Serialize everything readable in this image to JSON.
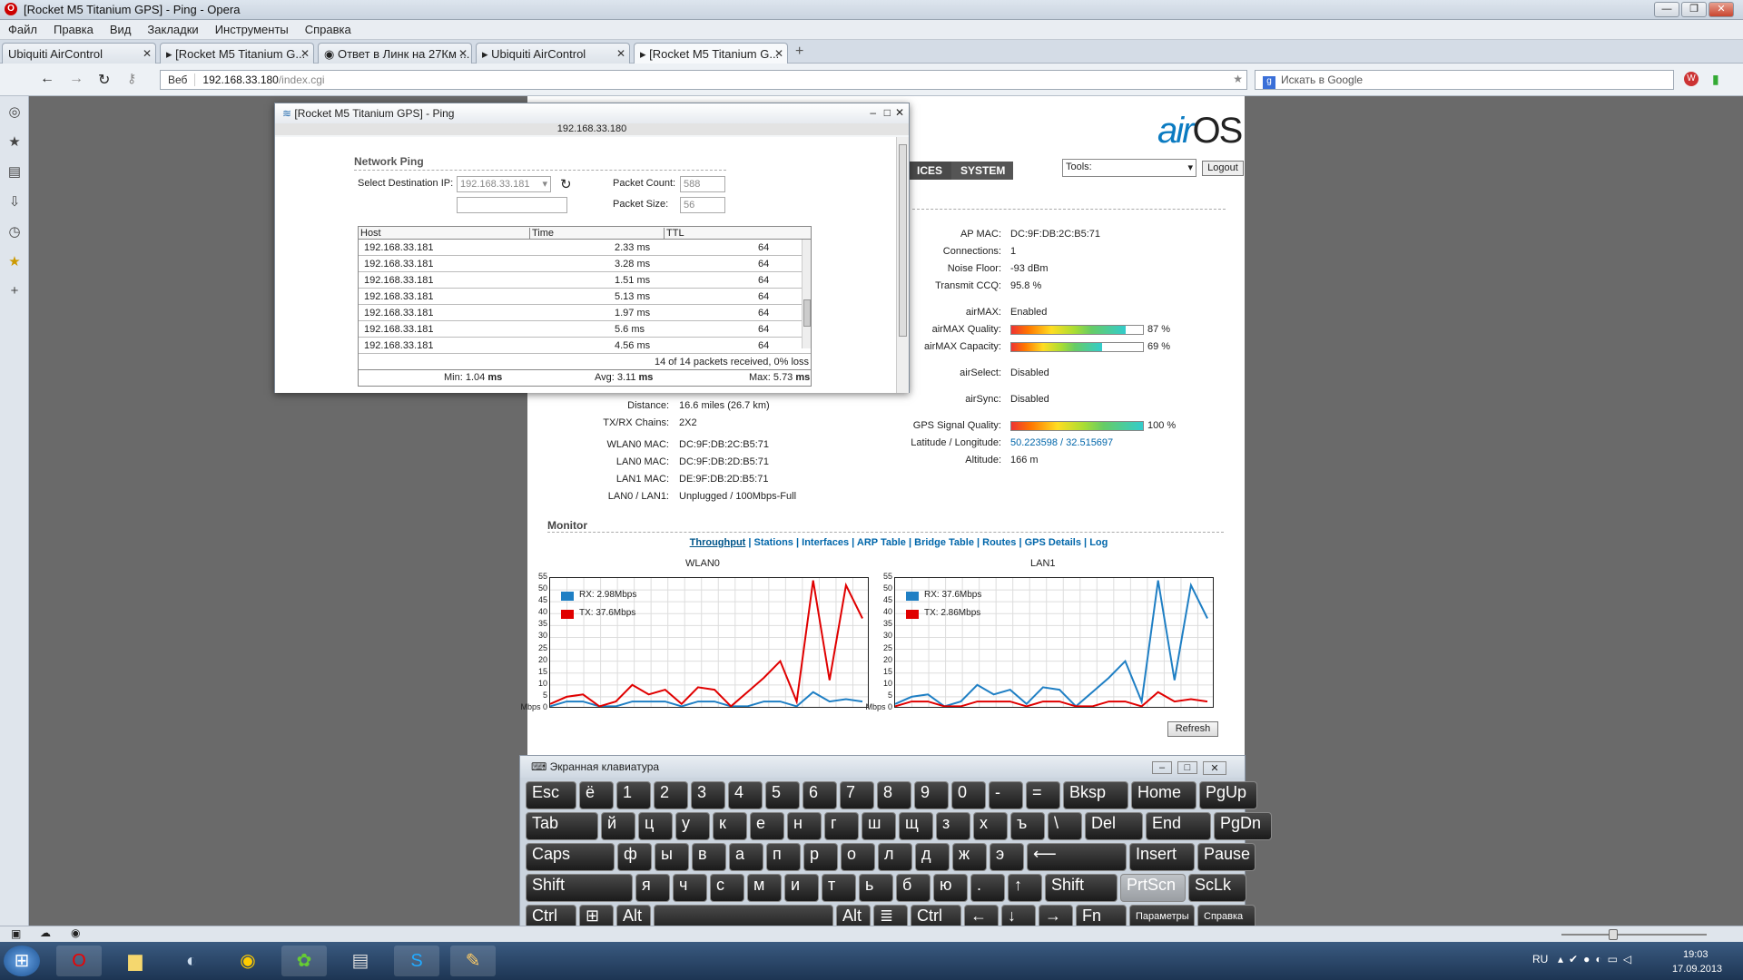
{
  "window": {
    "title": "[Rocket M5 Titanium GPS] - Ping - Opera"
  },
  "menu": [
    "Файл",
    "Правка",
    "Вид",
    "Закладки",
    "Инструменты",
    "Справка"
  ],
  "tabs": [
    {
      "label": "Ubiquiti AirControl"
    },
    {
      "label": "[Rocket M5 Titanium G..."
    },
    {
      "label": "Ответ в Линк на 27Км ..."
    },
    {
      "label": "Ubiquiti AirControl"
    },
    {
      "label": "[Rocket M5 Titanium G..."
    }
  ],
  "address": {
    "web": "Веб",
    "url_host": "192.168.33.180",
    "url_path": "/index.cgi",
    "search_placeholder": "Искать в Google"
  },
  "airos": {
    "logo_a": "air",
    "logo_b": "OS",
    "nav": [
      "ICES",
      "SYSTEM"
    ],
    "tools": "Tools:",
    "logout": "Logout",
    "right": [
      {
        "k": "AP MAC:",
        "v": "DC:9F:DB:2C:B5:71"
      },
      {
        "k": "Connections:",
        "v": "1"
      },
      {
        "k": "Noise Floor:",
        "v": "-93 dBm"
      },
      {
        "k": "Transmit CCQ:",
        "v": "95.8 %"
      },
      {
        "k": "airMAX:",
        "v": "Enabled"
      },
      {
        "k": "airMAX Quality:",
        "v": "87 %"
      },
      {
        "k": "airMAX Capacity:",
        "v": "69 %"
      },
      {
        "k": "airSelect:",
        "v": "Disabled"
      },
      {
        "k": "airSync:",
        "v": "Disabled"
      },
      {
        "k": "GPS Signal Quality:",
        "v": "100 %"
      },
      {
        "k": "Latitude / Longitude:",
        "v": "50.223598 / 32.515697"
      },
      {
        "k": "Altitude:",
        "v": "166 m"
      }
    ],
    "levels": {
      "airmax_quality": 0.87,
      "airmax_capacity": 0.69,
      "gps": 1.0
    },
    "left": [
      {
        "k": "Distance:",
        "v": "16.6 miles (26.7 km)"
      },
      {
        "k": "TX/RX Chains:",
        "v": "2X2"
      },
      {
        "k": "WLAN0 MAC:",
        "v": "DC:9F:DB:2C:B5:71"
      },
      {
        "k": "LAN0 MAC:",
        "v": "DC:9F:DB:2D:B5:71"
      },
      {
        "k": "LAN1 MAC:",
        "v": "DE:9F:DB:2D:B5:71"
      },
      {
        "k": "LAN0 / LAN1:",
        "v": "Unplugged / 100Mbps-Full"
      }
    ],
    "monitor": "Monitor",
    "monitor_links": [
      "Throughput",
      "Stations",
      "Interfaces",
      "ARP Table",
      "Bridge Table",
      "Routes",
      "GPS Details",
      "Log"
    ],
    "refresh": "Refresh"
  },
  "chart_data": [
    {
      "type": "line",
      "title": "WLAN0",
      "ylim": [
        0,
        55
      ],
      "yticks": [
        "55",
        "50",
        "45",
        "40",
        "35",
        "30",
        "25",
        "20",
        "15",
        "10",
        "5",
        "Mbps 0"
      ],
      "series": [
        {
          "name": "RX: 2.98Mbps",
          "color": "#1f7fc4",
          "values": [
            1,
            3,
            3,
            1,
            1,
            3,
            3,
            3,
            1,
            3,
            3,
            1,
            1,
            3,
            3,
            1,
            7,
            3,
            4,
            3
          ]
        },
        {
          "name": "TX: 37.6Mbps",
          "color": "#e00000",
          "values": [
            2,
            5,
            6,
            1,
            3,
            10,
            6,
            8,
            2,
            9,
            8,
            1,
            7,
            13,
            20,
            3,
            54,
            12,
            52,
            38
          ]
        }
      ]
    },
    {
      "type": "line",
      "title": "LAN1",
      "ylim": [
        0,
        55
      ],
      "yticks": [
        "55",
        "50",
        "45",
        "40",
        "35",
        "30",
        "25",
        "20",
        "15",
        "10",
        "5",
        "Mbps 0"
      ],
      "series": [
        {
          "name": "RX: 37.6Mbps",
          "color": "#1f7fc4",
          "values": [
            2,
            5,
            6,
            1,
            3,
            10,
            6,
            8,
            2,
            9,
            8,
            1,
            7,
            13,
            20,
            3,
            54,
            12,
            52,
            38
          ]
        },
        {
          "name": "TX: 2.86Mbps",
          "color": "#e00000",
          "values": [
            1,
            3,
            3,
            1,
            1,
            3,
            3,
            3,
            1,
            3,
            3,
            1,
            1,
            3,
            3,
            1,
            7,
            3,
            4,
            3
          ]
        }
      ]
    }
  ],
  "ping": {
    "title": "[Rocket M5 Titanium GPS] - Ping",
    "ip": "192.168.33.180",
    "section": "Network Ping",
    "dest_label": "Select Destination IP:",
    "dest_value": "192.168.33.181",
    "count_label": "Packet Count:",
    "count_value": "588",
    "size_label": "Packet Size:",
    "size_value": "56",
    "cols": [
      "Host",
      "Time",
      "TTL"
    ],
    "rows": [
      {
        "host": "192.168.33.181",
        "time": "2.33 ms",
        "ttl": "64"
      },
      {
        "host": "192.168.33.181",
        "time": "3.28 ms",
        "ttl": "64"
      },
      {
        "host": "192.168.33.181",
        "time": "1.51 ms",
        "ttl": "64"
      },
      {
        "host": "192.168.33.181",
        "time": "5.13 ms",
        "ttl": "64"
      },
      {
        "host": "192.168.33.181",
        "time": "1.97 ms",
        "ttl": "64"
      },
      {
        "host": "192.168.33.181",
        "time": "5.6 ms",
        "ttl": "64"
      },
      {
        "host": "192.168.33.181",
        "time": "4.56 ms",
        "ttl": "64"
      }
    ],
    "summary": "14 of 14 packets received, 0% loss",
    "min_label": "Min: 1.04",
    "avg_label": "Avg: 3.11",
    "max_label": "Max: 5.73",
    "unit": "ms"
  },
  "osk": {
    "title": "Экранная клавиатура",
    "rows": [
      [
        "Esc",
        "ё",
        "1",
        "2",
        "3",
        "4",
        "5",
        "6",
        "7",
        "8",
        "9",
        "0",
        "-",
        "=",
        "Bksp",
        "Home",
        "PgUp"
      ],
      [
        "Tab",
        "й",
        "ц",
        "у",
        "к",
        "е",
        "н",
        "г",
        "ш",
        "щ",
        "з",
        "х",
        "ъ",
        "\\",
        "Del",
        "End",
        "PgDn"
      ],
      [
        "Caps",
        "ф",
        "ы",
        "в",
        "а",
        "п",
        "р",
        "о",
        "л",
        "д",
        "ж",
        "э",
        "⟵",
        "Insert",
        "Pause"
      ],
      [
        "Shift",
        "я",
        "ч",
        "с",
        "м",
        "и",
        "т",
        "ь",
        "б",
        "ю",
        ".",
        "↑",
        "Shift",
        "PrtScn",
        "ScLk"
      ],
      [
        "Ctrl",
        "⊞",
        "Alt",
        " ",
        "Alt",
        "≣",
        "Ctrl",
        "←",
        "↓",
        "→",
        "Fn",
        "Параметры",
        "Справка"
      ]
    ]
  },
  "taskbar": {
    "lang": "RU",
    "time": "19:03",
    "date": "17.09.2013"
  }
}
